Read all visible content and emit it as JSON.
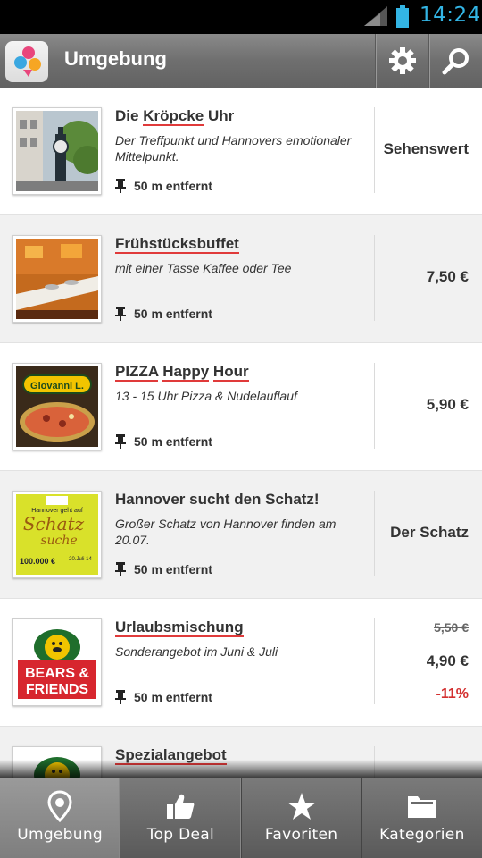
{
  "status_bar": {
    "time": "14:24",
    "time_color": "#33b5e5"
  },
  "action_bar": {
    "title": "Umgebung",
    "app_icon": "map-balloon-app-icon",
    "settings_icon": "gear-icon",
    "search_icon": "search-icon"
  },
  "accent_color": "#e03a3a",
  "items": [
    {
      "title_parts": [
        "Die ",
        "Kröpcke",
        " Uhr"
      ],
      "description": "Der Treffpunkt und Hannovers emotionaler Mittelpunkt.",
      "distance": "50 m entfernt",
      "side_text": "Sehenswert",
      "thumbnail": "clock-tower-photo"
    },
    {
      "title_parts": [
        "",
        "Frühstücksbuffet",
        ""
      ],
      "description": "mit einer Tasse Kaffee oder  Tee",
      "distance": "50 m entfernt",
      "side_text": "7,50 €",
      "thumbnail": "buffet-photo"
    },
    {
      "title_parts": [
        "",
        "PIZZA",
        " ",
        "Happy",
        " ",
        "Hour",
        ""
      ],
      "description": "13 - 15 Uhr Pizza & Nudelauflauf",
      "distance": "50 m entfernt",
      "side_text": "5,90 €",
      "thumbnail": "pizza-logo",
      "thumb_text": "Giovanni L."
    },
    {
      "title_parts": [
        "Hannover sucht den Schatz!"
      ],
      "description": "Großer Schatz von Hannover finden am 20.07.",
      "distance": "50 m entfernt",
      "side_text": "Der Schatz",
      "thumbnail": "treasure-hunt-poster",
      "thumb_text": [
        "Hannover geht auf",
        "Schatz",
        "suche",
        "100.000 €",
        "20.Juli 14"
      ]
    },
    {
      "title_parts": [
        "",
        "Urlaubsmischung",
        ""
      ],
      "description": "Sonderangebot im Juni & Juli",
      "distance": "50 m entfernt",
      "old_price": "5,50 €",
      "new_price": "4,90 €",
      "discount": "-11%",
      "thumbnail": "bears-friends-logo",
      "thumb_text": [
        "BEARS &",
        "FRIENDS"
      ]
    },
    {
      "title_parts": [
        "",
        "Spezialangebot",
        ""
      ],
      "thumbnail": "bears-friends-logo"
    }
  ],
  "tabs": [
    {
      "label": "Umgebung",
      "icon": "location-pin-icon",
      "active": true
    },
    {
      "label": "Top Deal",
      "icon": "thumbs-up-icon",
      "active": false
    },
    {
      "label": "Favoriten",
      "icon": "star-icon",
      "active": false
    },
    {
      "label": "Kategorien",
      "icon": "folder-icon",
      "active": false
    }
  ]
}
